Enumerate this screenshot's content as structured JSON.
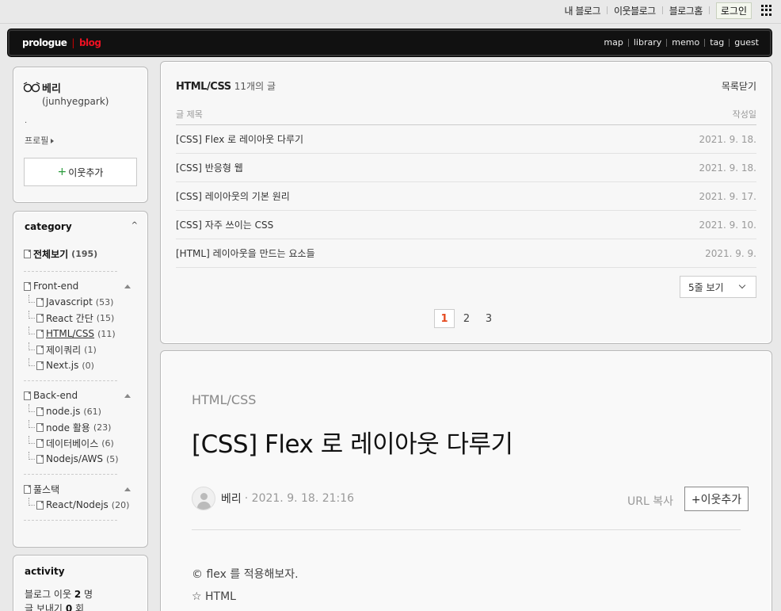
{
  "gnb": {
    "links": [
      "내 블로그",
      "이웃블로그",
      "블로그홈"
    ],
    "login": "로그인",
    "apps_icon": "grid-icon"
  },
  "blog": {
    "brand_prologue": "prologue",
    "brand_sep": "|",
    "brand_blog": "blog",
    "menu": [
      "map",
      "library",
      "memo",
      "tag",
      "guest"
    ]
  },
  "profile": {
    "name": "베리",
    "id": "(junhyegpark)",
    "dot": ".",
    "profile_link": "프로필",
    "add_neighbor": "이웃추가",
    "plus": "+"
  },
  "category": {
    "title": "category",
    "toggle": "^",
    "all": {
      "label": "전체보기",
      "count": "(195)"
    },
    "groups": [
      {
        "label": "Front-end",
        "items": [
          {
            "label": "Javascript",
            "count": "(53)"
          },
          {
            "label": "React 간단",
            "count": "(15)"
          },
          {
            "label": "HTML/CSS",
            "count": "(11)"
          },
          {
            "label": "제이쿼리",
            "count": "(1)"
          },
          {
            "label": "Next.js",
            "count": "(0)"
          }
        ]
      },
      {
        "label": "Back-end",
        "items": [
          {
            "label": "node.js",
            "count": "(61)"
          },
          {
            "label": "node 활용",
            "count": "(23)"
          },
          {
            "label": "데이터베이스",
            "count": "(6)"
          },
          {
            "label": "Nodejs/AWS",
            "count": "(5)"
          }
        ]
      },
      {
        "label": "풀스택",
        "items": [
          {
            "label": "React/Nodejs",
            "count": "(20)"
          }
        ]
      }
    ]
  },
  "activity": {
    "title": "activity",
    "neighbors_label": "블로그 이웃",
    "neighbors_count": "2",
    "neighbors_unit": "명",
    "posts_label": "글 보내기",
    "posts_count": "0",
    "posts_unit": "회"
  },
  "postlist": {
    "category": "HTML/CSS",
    "count_text": "11개의 글",
    "close": "목록닫기",
    "col_title": "글 제목",
    "col_date": "작성일",
    "rows": [
      {
        "title": "[CSS] Flex 로 레이아웃 다루기",
        "date": "2021. 9. 18."
      },
      {
        "title": "[CSS] 반응형 웹",
        "date": "2021. 9. 18."
      },
      {
        "title": "[CSS] 레이아웃의 기본 원리",
        "date": "2021. 9. 17."
      },
      {
        "title": "[CSS] 자주 쓰이는 CSS",
        "date": "2021. 9. 10."
      },
      {
        "title": "[HTML] 레이아웃을 만드는 요소들",
        "date": "2021. 9. 9."
      }
    ],
    "page_size": "5줄 보기",
    "pages": [
      "1",
      "2",
      "3"
    ],
    "current_page": "1"
  },
  "post": {
    "category": "HTML/CSS",
    "title": "[CSS] Flex 로 레이아웃 다루기",
    "author": "베리",
    "date": "· 2021. 9. 18. 21:16",
    "url_copy": "URL 복사",
    "add_neighbor": "+이웃추가",
    "body": [
      "© flex 를 적용해보자.",
      "☆ HTML"
    ]
  }
}
